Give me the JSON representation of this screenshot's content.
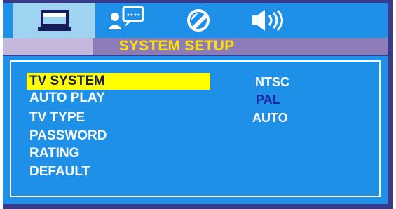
{
  "window": {
    "title": "SYSTEM SETUP"
  },
  "tabs": [
    {
      "name": "system",
      "icon": "monitor-icon",
      "active": true
    },
    {
      "name": "language",
      "icon": "person-speech-icon",
      "active": false
    },
    {
      "name": "video",
      "icon": "circle-slash-icon",
      "active": false
    },
    {
      "name": "audio",
      "icon": "speaker-icon",
      "active": false
    }
  ],
  "menu": {
    "items": [
      {
        "label": "TV SYSTEM",
        "selected": true
      },
      {
        "label": "AUTO PLAY",
        "selected": false
      },
      {
        "label": "TV TYPE",
        "selected": false
      },
      {
        "label": "PASSWORD",
        "selected": false
      },
      {
        "label": "RATING",
        "selected": false
      },
      {
        "label": "DEFAULT",
        "selected": false
      }
    ]
  },
  "options": {
    "items": [
      {
        "label": "NTSC",
        "current": false
      },
      {
        "label": "PAL",
        "current": true
      },
      {
        "label": "AUTO",
        "current": false
      }
    ]
  },
  "colors": {
    "frame": "#3a3a8c",
    "panel": "#1e90e8",
    "active_tab": "#9ed3f2",
    "title": "#ffe000",
    "highlight": "#ffff00",
    "current_option": "#1a2aa8"
  }
}
